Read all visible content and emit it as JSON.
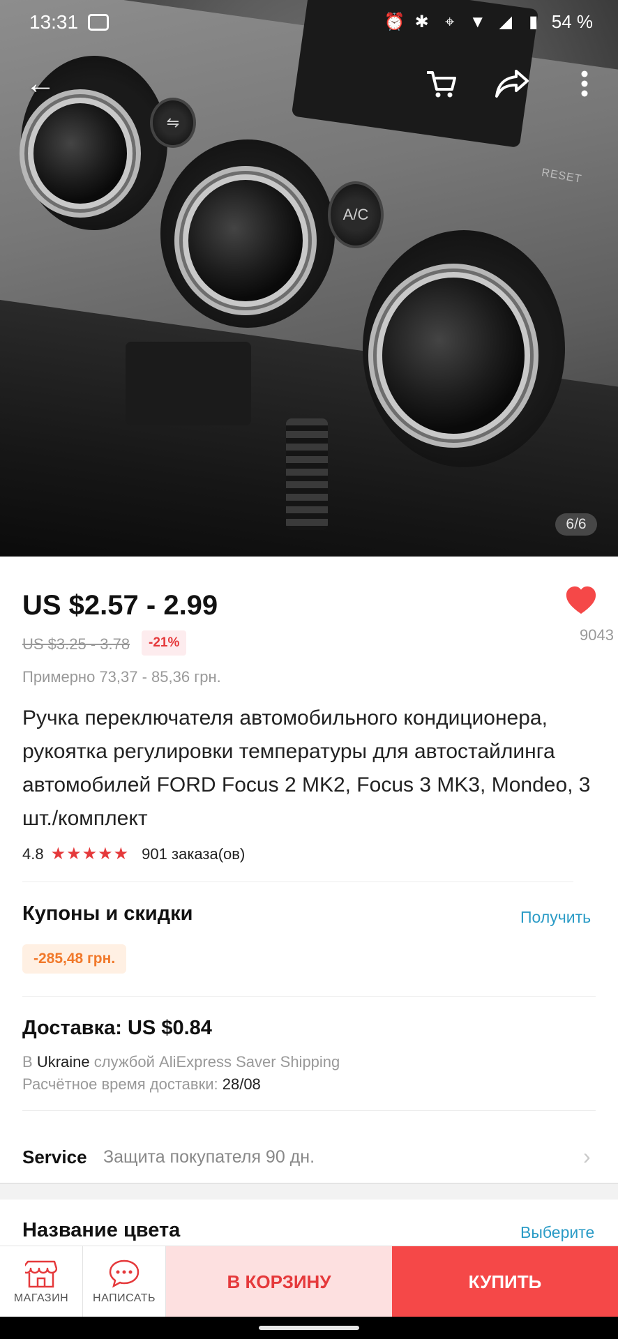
{
  "status_bar": {
    "time": "13:31",
    "battery": "54 %",
    "icons": [
      "message-icon",
      "alarm-icon",
      "bluetooth-icon",
      "location-icon",
      "wifi-icon",
      "signal-icon",
      "battery-icon"
    ]
  },
  "gallery": {
    "counter": "6/6",
    "image_labels": {
      "ac_button": "A/C",
      "reset": "RESET"
    }
  },
  "top_nav": {
    "icons": [
      "back-arrow-icon",
      "cart-icon",
      "share-icon",
      "more-vertical-icon"
    ]
  },
  "product": {
    "price": "US $2.57 - 2.99",
    "old_price": "US $3.25 - 3.78",
    "discount": "-21%",
    "approx_local": "Примерно 73,37 - 85,36 грн.",
    "wishlist_count": "9043",
    "title": "Ручка переключателя автомобильного кондиционера, рукоятка регулировки температуры для автостайлинга автомобилей FORD Focus 2 MK2, Focus 3 MK3, Mondeo, 3 шт./комплект",
    "rating": "4.8",
    "stars": "★★★★★",
    "orders": "901 заказа(ов)"
  },
  "coupons": {
    "title": "Купоны и скидки",
    "action": "Получить",
    "coupon_value": "-285,48 грн."
  },
  "shipping": {
    "title": "Доставка: US $0.84",
    "line1_prefix": "В",
    "line1_country": "Ukraine",
    "line1_suffix": "службой AliExpress Saver Shipping",
    "line2_prefix": "Расчётное время доставки:",
    "line2_date": "28/08"
  },
  "service": {
    "label": "Service",
    "text": "Защита покупателя 90 дн."
  },
  "color": {
    "title": "Название цвета",
    "action": "Выберите"
  },
  "bottom_bar": {
    "store_label": "МАГАЗИН",
    "message_label": "НАПИСАТЬ",
    "cart_label": "В КОРЗИНУ",
    "buy_label": "КУПИТЬ"
  },
  "colors": {
    "accent_red": "#e5393b",
    "buy_red": "#f54848",
    "link_blue": "#2a9bc6",
    "coupon_orange": "#f1792b"
  }
}
